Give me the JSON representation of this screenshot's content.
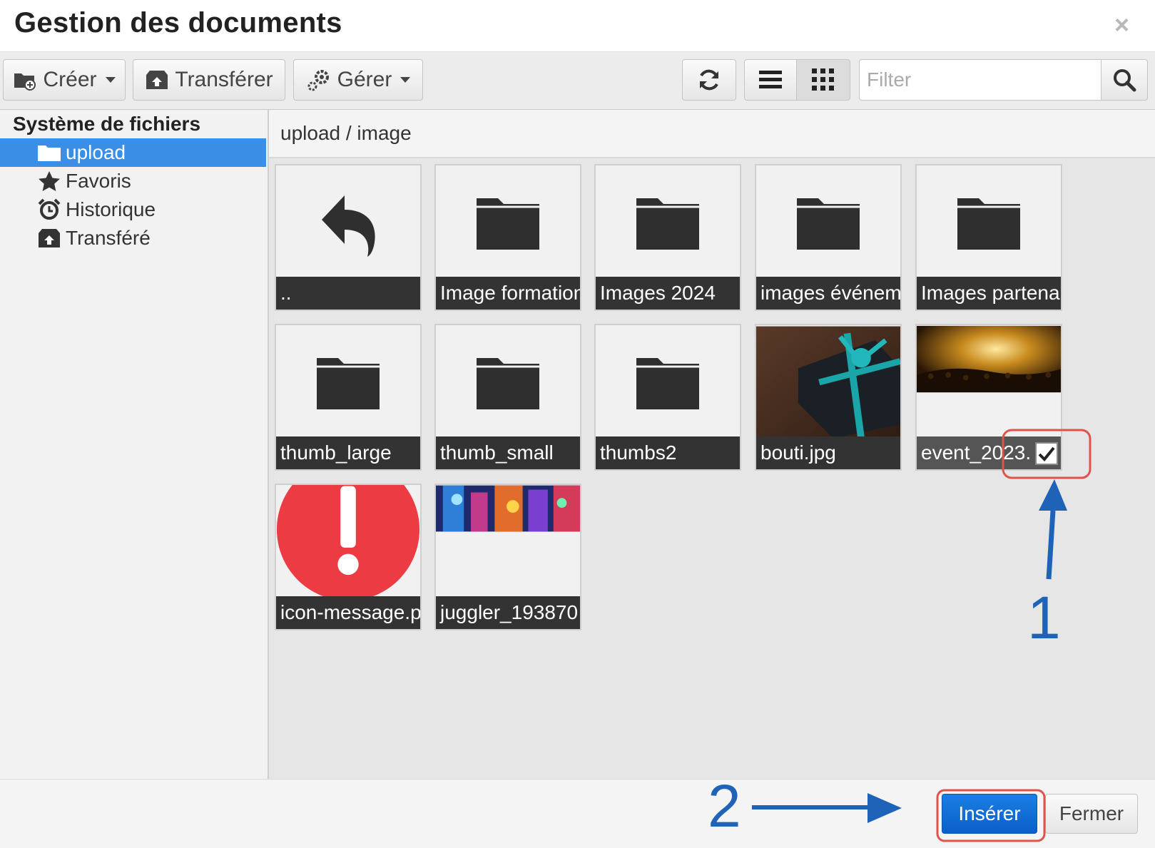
{
  "dialog": {
    "title": "Gestion des documents"
  },
  "toolbar": {
    "create_label": "Créer",
    "upload_label": "Transférer",
    "manage_label": "Gérer",
    "filter_placeholder": "Filter"
  },
  "sidebar": {
    "title": "Système de fichiers",
    "items": [
      {
        "label": "upload",
        "icon": "folder-icon",
        "active": true
      },
      {
        "label": "Favoris",
        "icon": "star-icon"
      },
      {
        "label": "Historique",
        "icon": "alarm-clock-icon"
      },
      {
        "label": "Transféré",
        "icon": "upload-box-icon"
      }
    ]
  },
  "breadcrumb": "upload / image",
  "files": [
    {
      "label": "..",
      "type": "parent-folder"
    },
    {
      "label": "Image formation",
      "type": "folder"
    },
    {
      "label": "Images 2024",
      "type": "folder"
    },
    {
      "label": "images événements",
      "type": "folder"
    },
    {
      "label": "Images partenaires",
      "type": "folder"
    },
    {
      "label": "thumb_large",
      "type": "folder"
    },
    {
      "label": "thumb_small",
      "type": "folder"
    },
    {
      "label": "thumbs2",
      "type": "folder"
    },
    {
      "label": "bouti.jpg",
      "type": "image"
    },
    {
      "label": "event_2023.",
      "type": "image",
      "selected": true
    },
    {
      "label": "icon-message.p",
      "type": "image"
    },
    {
      "label": "juggler_193870",
      "type": "image"
    }
  ],
  "footer": {
    "insert_label": "Insérer",
    "close_label": "Fermer"
  },
  "annotations": {
    "step1": "1",
    "step2": "2",
    "color": "#1e63b8",
    "highlight_color": "#e0534a"
  },
  "colors": {
    "accent": "#3a8ee6",
    "primary_button": "#0b5fc8",
    "tile_label_bg": "#333333"
  }
}
